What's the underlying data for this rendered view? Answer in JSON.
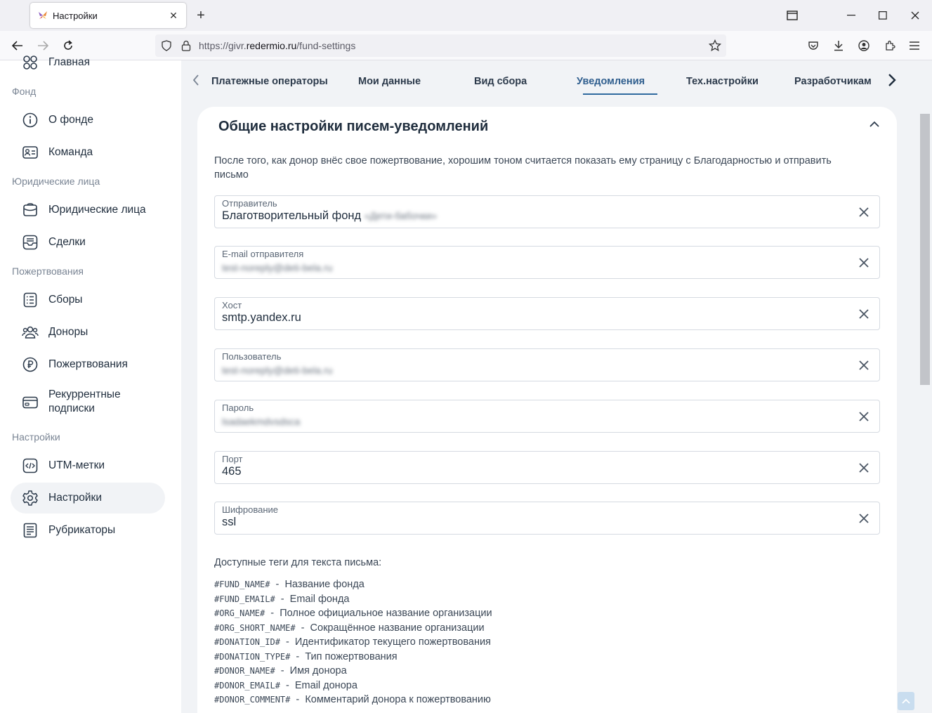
{
  "browser": {
    "tab_title": "Настройки",
    "url_prefix": "https://givr.",
    "url_domain": "redermio.ru",
    "url_path": "/fund-settings"
  },
  "sidebar": {
    "top_item": "Главная",
    "sections": [
      {
        "title": "Фонд"
      },
      {
        "title": "Юридические лица"
      },
      {
        "title": "Пожертвования"
      },
      {
        "title": "Настройки"
      }
    ],
    "items": [
      {
        "label": "О фонде",
        "icon": "info-icon"
      },
      {
        "label": "Команда",
        "icon": "id-card-icon"
      },
      {
        "label": "Юридические лица",
        "icon": "briefcase-icon"
      },
      {
        "label": "Сделки",
        "icon": "inbox-icon"
      },
      {
        "label": "Сборы",
        "icon": "list-icon"
      },
      {
        "label": "Доноры",
        "icon": "users-icon"
      },
      {
        "label": "Пожертвования",
        "icon": "ruble-icon"
      },
      {
        "label": "Рекуррентные подписки",
        "line1": "Рекуррентные",
        "line2": "подписки",
        "icon": "card-icon"
      },
      {
        "label": "UTM-метки",
        "icon": "code-icon"
      },
      {
        "label": "Настройки",
        "icon": "gear-icon",
        "active": true
      },
      {
        "label": "Рубрикаторы",
        "icon": "catalog-icon"
      }
    ]
  },
  "settings_tabs": [
    "Платежные операторы",
    "Мои данные",
    "Вид сбора",
    "Уведомления",
    "Тех.настройки",
    "Разработчикам"
  ],
  "active_tab": "Уведомления",
  "card": {
    "title": "Общие настройки писем-уведомлений",
    "intro": "После того, как донор внёс свое пожертвование, хорошим тоном считается показать ему страницу с Благодарностью и отправить письмо",
    "fields": [
      {
        "label": "Отправитель",
        "value": "Благотворительный фонд",
        "blurred": "«Дети-бабочки»"
      },
      {
        "label": "E-mail отправителя",
        "blurred": "test-noreply@deti-bela.ru"
      },
      {
        "label": "Хост",
        "value": "smtp.yandex.ru"
      },
      {
        "label": "Пользователь",
        "blurred": "test-noreply@deti-bela.ru"
      },
      {
        "label": "Пароль",
        "blurred": "lsadaekmdvsdsca"
      },
      {
        "label": "Порт",
        "value": "465"
      },
      {
        "label": "Шифрование",
        "value": "ssl"
      }
    ],
    "tags_title": "Доступные теги для текста письма:",
    "tags": [
      {
        "code": "#FUND_NAME#",
        "desc": "Название фонда"
      },
      {
        "code": "#FUND_EMAIL#",
        "desc": "Email фонда"
      },
      {
        "code": "#ORG_NAME#",
        "desc": "Полное официальное название организации"
      },
      {
        "code": "#ORG_SHORT_NAME#",
        "desc": "Сокращённое название организации"
      },
      {
        "code": "#DONATION_ID#",
        "desc": "Идентификатор текущего пожертвования"
      },
      {
        "code": "#DONATION_TYPE#",
        "desc": "Тип пожертвования"
      },
      {
        "code": "#DONOR_NAME#",
        "desc": "Имя донора"
      },
      {
        "code": "#DONOR_EMAIL#",
        "desc": "Email донора"
      },
      {
        "code": "#DONOR_COMMENT#",
        "desc": "Комментарий донора к пожертвованию"
      }
    ]
  },
  "colors": {
    "accent": "#2f6a9e",
    "sidebar_active": "#f1f3f6",
    "text": "#1f2d3d"
  }
}
